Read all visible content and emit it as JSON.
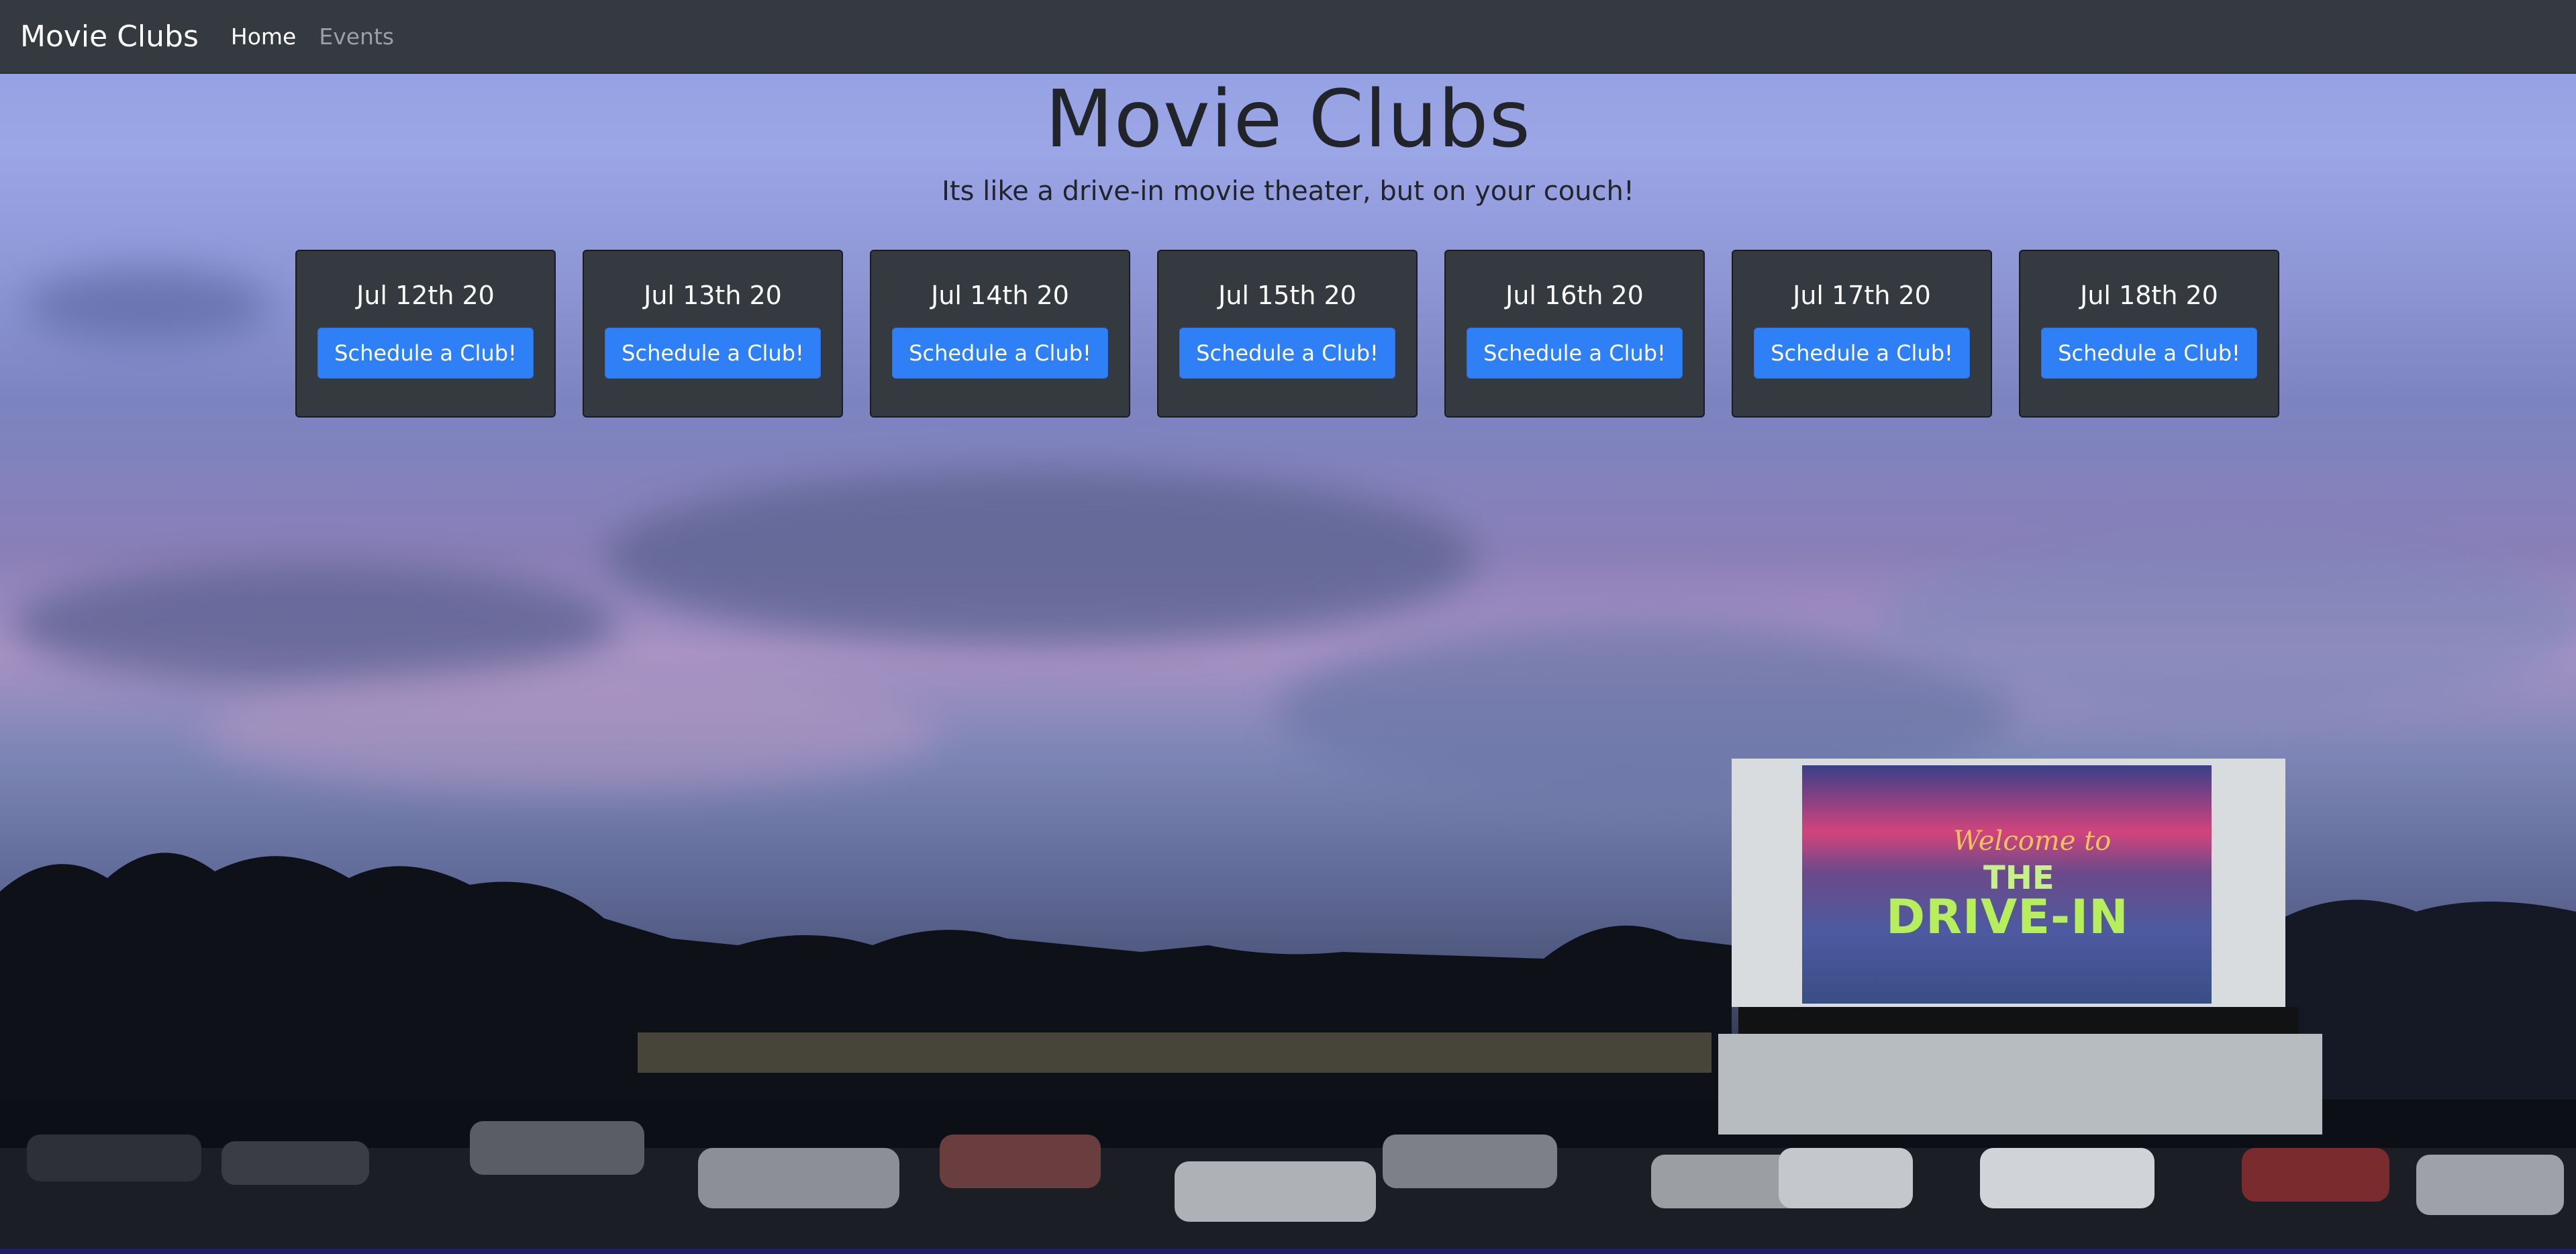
{
  "navbar": {
    "brand": "Movie Clubs",
    "links": [
      {
        "label": "Home",
        "active": true
      },
      {
        "label": "Events",
        "active": false
      }
    ]
  },
  "hero": {
    "title": "Movie Clubs",
    "subtitle": "Its like a drive-in movie theater, but on your couch!"
  },
  "days": [
    {
      "date": "Jul 12th 20",
      "button": "Schedule a Club!"
    },
    {
      "date": "Jul 13th 20",
      "button": "Schedule a Club!"
    },
    {
      "date": "Jul 14th 20",
      "button": "Schedule a Club!"
    },
    {
      "date": "Jul 15th 20",
      "button": "Schedule a Club!"
    },
    {
      "date": "Jul 16th 20",
      "button": "Schedule a Club!"
    },
    {
      "date": "Jul 17th 20",
      "button": "Schedule a Club!"
    },
    {
      "date": "Jul 18th 20",
      "button": "Schedule a Club!"
    }
  ],
  "background_screen": {
    "line1": "Welcome to",
    "line2": "THE",
    "line3": "DRIVE-IN"
  },
  "colors": {
    "navbar": "#343a40",
    "card": "#343a40",
    "button": "#2f7ff6"
  }
}
